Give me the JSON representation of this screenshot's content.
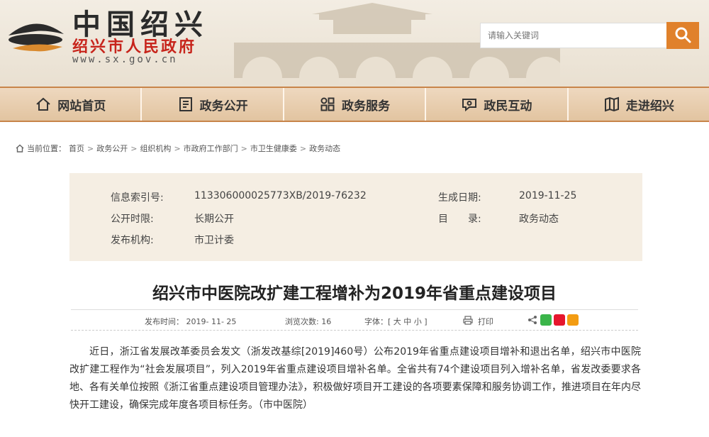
{
  "header": {
    "title": "中国绍兴",
    "subtitle": "绍兴市人民政府",
    "url": "www.sx.gov.cn",
    "search_placeholder": "请输入关键词"
  },
  "nav": {
    "items": [
      {
        "label": "网站首页",
        "icon": "home-icon"
      },
      {
        "label": "政务公开",
        "icon": "document-icon"
      },
      {
        "label": "政务服务",
        "icon": "grid-icon"
      },
      {
        "label": "政民互动",
        "icon": "chat-icon"
      },
      {
        "label": "走进绍兴",
        "icon": "map-icon"
      }
    ]
  },
  "breadcrumb": {
    "prefix": "当前位置：",
    "items": [
      "首页",
      "政务公开",
      "组织机构",
      "市政府工作部门",
      "市卫生健康委",
      "政务动态"
    ]
  },
  "info": {
    "index_label": "信息索引号:",
    "index_value": "113306000025773XB/2019-76232",
    "date_label": "生成日期:",
    "date_value": "2019-11-25",
    "period_label": "公开时限:",
    "period_value": "长期公开",
    "catalog_label": "目　　录:",
    "catalog_value": "政务动态",
    "org_label": "发布机构:",
    "org_value": "市卫计委"
  },
  "article": {
    "title": "绍兴市中医院改扩建工程增补为2019年省重点建设项目",
    "publish_time": "发布时间： 2019- 11- 25",
    "views": "浏览次数: 16",
    "font_size": "字体：[ 大 中 小 ]",
    "print": "打印",
    "body": "近日，浙江省发展改革委员会发文（浙发改基综[2019]460号）公布2019年省重点建设项目增补和退出名单，绍兴市中医院改扩建工程作为“社会发展项目”，列入2019年省重点建设项目增补名单。全省共有74个建设项目列入增补名单，省发改委要求各地、各有关单位按照《浙江省重点建设项目管理办法》，积极做好项目开工建设的各项要素保障和服务协调工作，推进项目在年内尽快开工建设，确保完成年度各项目标任务。（市中医院）"
  },
  "colors": {
    "accent": "#e0812b",
    "brand_red": "#c7241b",
    "nav_bg": "#e8cdab",
    "info_bg": "#f5eee3"
  }
}
